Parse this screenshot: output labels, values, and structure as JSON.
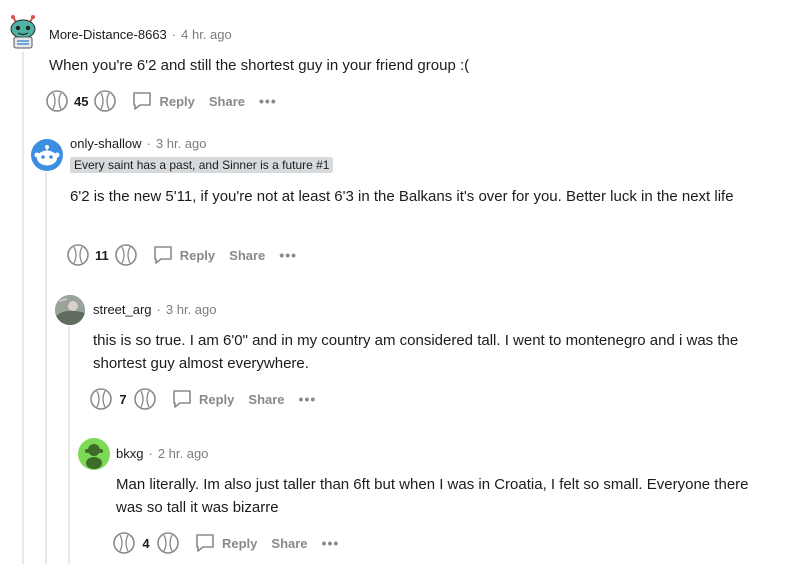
{
  "comments": [
    {
      "user": "More-Distance-8663",
      "time": "4 hr. ago",
      "body": "When you're 6'2 and still the shortest guy in your friend group :(",
      "score": "45",
      "reply": "Reply",
      "share": "Share",
      "more": "•••"
    },
    {
      "user": "only-shallow",
      "time": "3 hr. ago",
      "flair": "Every saint has a past, and Sinner is a future #1",
      "body": "6'2 is the new 5'11, if you're not at least 6'3 in the Balkans it's over for you. Better luck in the next life",
      "score": "11",
      "reply": "Reply",
      "share": "Share",
      "more": "•••"
    },
    {
      "user": "street_arg",
      "time": "3 hr. ago",
      "body": "this is so true. I am 6'0\" and in my country am considered tall. I went to montenegro and i was the shortest guy almost everywhere.",
      "score": "7",
      "reply": "Reply",
      "share": "Share",
      "more": "•••"
    },
    {
      "user": "bkxg",
      "time": "2 hr. ago",
      "body": "Man literally. Im also just taller than 6ft but when I was in Croatia, I felt so small. Everyone there was so tall it was bizarre",
      "score": "4",
      "reply": "Reply",
      "share": "Share",
      "more": "•••"
    }
  ],
  "colors": {
    "meta_gray": "#7c7c7c",
    "action_gray": "#878a8c",
    "flair_bg": "#d7dadc",
    "thread_line": "#e6e8ea",
    "avatar_blue": "#3b8ee0",
    "avatar_green": "#7ed957"
  },
  "icons": [
    "snoo-avatar-icon",
    "upvote-icon",
    "downvote-icon",
    "comment-bubble-icon"
  ]
}
